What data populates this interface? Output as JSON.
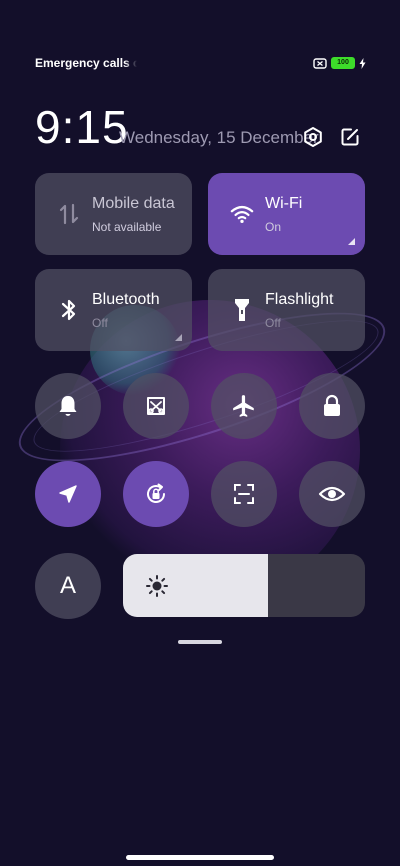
{
  "status_bar": {
    "carrier_text": "Emergency calls o",
    "battery_level": "100",
    "icons": [
      "no-sim-icon",
      "battery-icon",
      "charging-icon"
    ]
  },
  "header": {
    "time": "9:15",
    "date": "Wednesday, 15 December",
    "icons": [
      "settings-icon",
      "edit-icon"
    ]
  },
  "tiles": [
    {
      "key": "mobile-data",
      "label": "Mobile data",
      "status": "Not available",
      "active": false,
      "icon": "mobile-data-icon"
    },
    {
      "key": "wifi",
      "label": "Wi-Fi",
      "status": "On",
      "active": true,
      "icon": "wifi-icon"
    },
    {
      "key": "bluetooth",
      "label": "Bluetooth",
      "status": "Off",
      "active": false,
      "icon": "bluetooth-icon"
    },
    {
      "key": "flashlight",
      "label": "Flashlight",
      "status": "Off",
      "active": false,
      "icon": "flashlight-icon"
    }
  ],
  "toggles": [
    {
      "key": "sound",
      "icon": "bell-icon",
      "active": false
    },
    {
      "key": "screenshot",
      "icon": "screenshot-icon",
      "active": false
    },
    {
      "key": "airplane",
      "icon": "airplane-icon",
      "active": false
    },
    {
      "key": "lock-screen",
      "icon": "lock-icon",
      "active": false
    },
    {
      "key": "location",
      "icon": "location-arrow-icon",
      "active": true
    },
    {
      "key": "auto-rotate",
      "icon": "rotation-lock-icon",
      "active": true
    },
    {
      "key": "scanner",
      "icon": "scan-icon",
      "active": false
    },
    {
      "key": "reading-mode",
      "icon": "eye-icon",
      "active": false
    },
    {
      "key": "auto-brightness",
      "icon": "auto-brightness-icon",
      "label": "A",
      "active": false
    }
  ],
  "brightness": {
    "level_fraction": 0.6,
    "icon": "sun-icon"
  },
  "colors": {
    "background": "#130f2a",
    "accent": "#6c4bb1",
    "tile_inactive": "#52506a",
    "battery_green": "#3ddc2a"
  }
}
